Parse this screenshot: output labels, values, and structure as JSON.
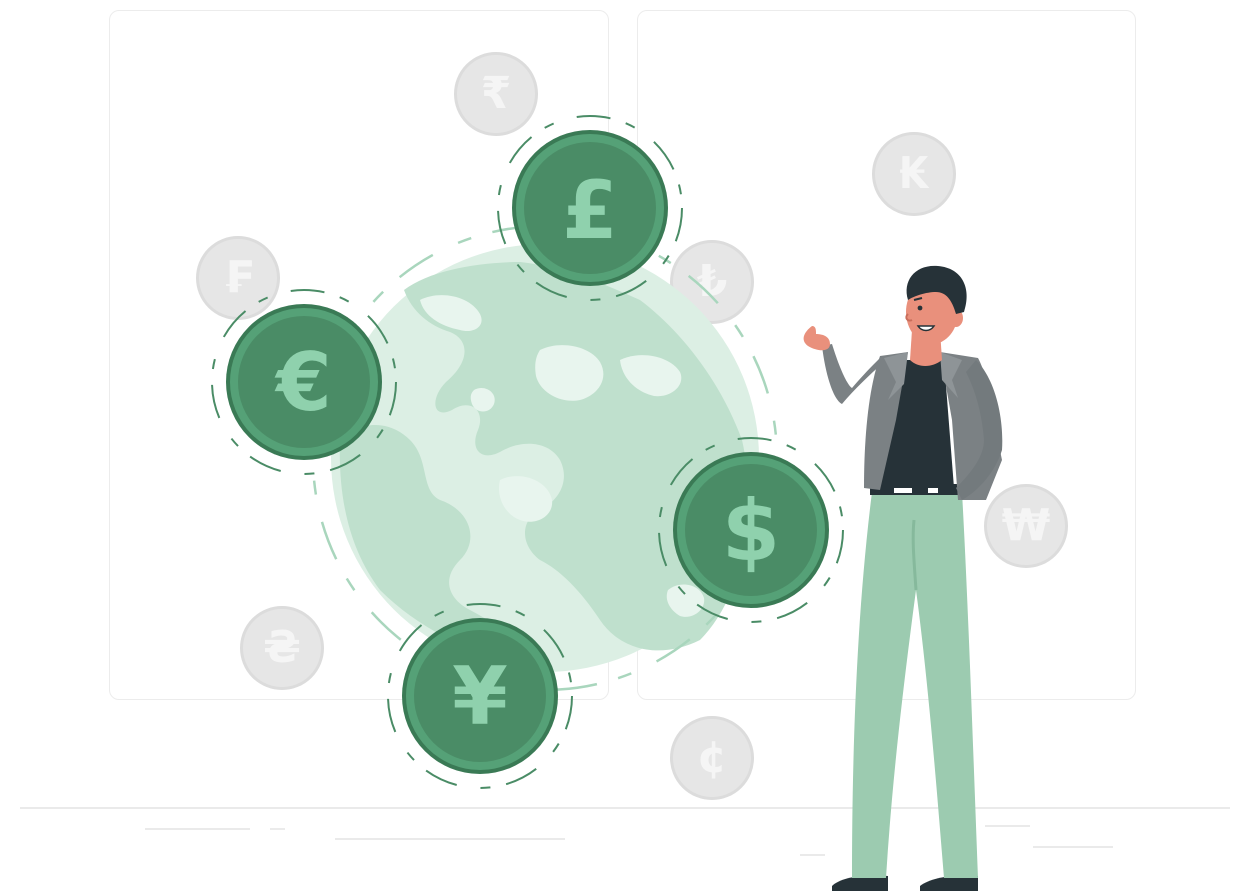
{
  "colors": {
    "coin_dark": "#3f8a5f",
    "coin_face": "#4a8c66",
    "coin_label": "#8fd1ad",
    "globe_land": "#bfe0cd",
    "globe_sea": "#dcefe4",
    "gray_coin": "#e6e6e6",
    "jacket": "#7b8184",
    "shirt": "#263238",
    "pants": "#9ccbb0",
    "skin": "#e9907c"
  },
  "green_coins": [
    {
      "symbol": "£",
      "icon": "pound-coin-icon"
    },
    {
      "symbol": "€",
      "icon": "euro-coin-icon"
    },
    {
      "symbol": "$",
      "icon": "dollar-coin-icon"
    },
    {
      "symbol": "¥",
      "icon": "yen-coin-icon"
    }
  ],
  "gray_coins": [
    {
      "symbol": "₹",
      "icon": "rupee-coin-icon"
    },
    {
      "symbol": "₣",
      "icon": "franc-coin-icon"
    },
    {
      "symbol": "₭",
      "icon": "kip-coin-icon"
    },
    {
      "symbol": "₺",
      "icon": "lira-coin-icon"
    },
    {
      "symbol": "₩",
      "icon": "won-coin-icon"
    },
    {
      "symbol": "₴",
      "icon": "hryvnia-coin-icon"
    },
    {
      "symbol": "¢",
      "icon": "cent-coin-icon"
    }
  ]
}
